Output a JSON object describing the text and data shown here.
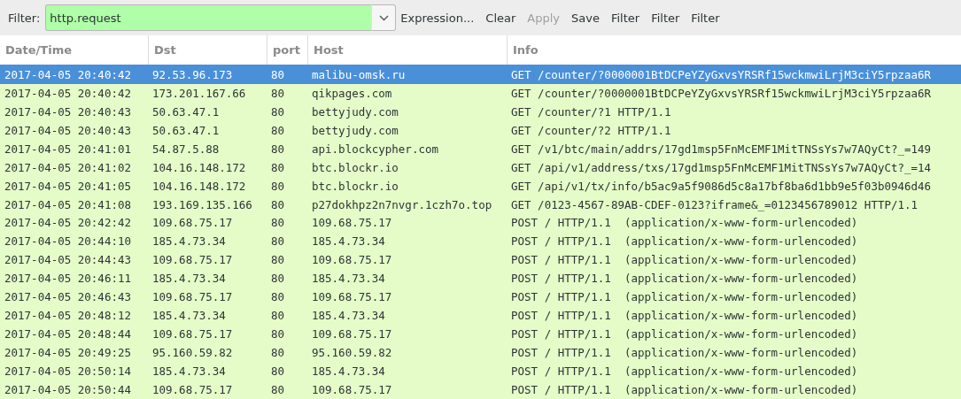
{
  "toolbar": {
    "filter_label": "Filter:",
    "filter_value": "http.request",
    "filter_valid": true,
    "buttons": [
      {
        "label": "Expression...",
        "disabled": false
      },
      {
        "label": "Clear",
        "disabled": false
      },
      {
        "label": "Apply",
        "disabled": true
      },
      {
        "label": "Save",
        "disabled": false
      },
      {
        "label": "Filter",
        "disabled": false
      },
      {
        "label": "Filter",
        "disabled": false
      },
      {
        "label": "Filter",
        "disabled": false
      }
    ]
  },
  "table": {
    "columns": [
      "Date/Time",
      "Dst",
      "port",
      "Host",
      "Info"
    ],
    "rows": [
      {
        "selected": true,
        "cells": [
          "2017-04-05 20:40:42",
          "92.53.96.173",
          "80",
          "malibu-omsk.ru",
          "GET /counter/?0000001BtDCPeYZyGxvsYRSRf15wckmwiLrjM3ciY5rpzaa6R"
        ]
      },
      {
        "selected": false,
        "cells": [
          "2017-04-05 20:40:42",
          "173.201.167.66",
          "80",
          "qikpages.com",
          "GET /counter/?0000001BtDCPeYZyGxvsYRSRf15wckmwiLrjM3ciY5rpzaa6R"
        ]
      },
      {
        "selected": false,
        "cells": [
          "2017-04-05 20:40:43",
          "50.63.47.1",
          "80",
          "bettyjudy.com",
          "GET /counter/?1 HTTP/1.1"
        ]
      },
      {
        "selected": false,
        "cells": [
          "2017-04-05 20:40:43",
          "50.63.47.1",
          "80",
          "bettyjudy.com",
          "GET /counter/?2 HTTP/1.1"
        ]
      },
      {
        "selected": false,
        "cells": [
          "2017-04-05 20:41:01",
          "54.87.5.88",
          "80",
          "api.blockcypher.com",
          "GET /v1/btc/main/addrs/17gd1msp5FnMcEMF1MitTNSsYs7w7AQyCt?_=149"
        ]
      },
      {
        "selected": false,
        "cells": [
          "2017-04-05 20:41:02",
          "104.16.148.172",
          "80",
          "btc.blockr.io",
          "GET /api/v1/address/txs/17gd1msp5FnMcEMF1MitTNSsYs7w7AQyCt?_=14"
        ]
      },
      {
        "selected": false,
        "cells": [
          "2017-04-05 20:41:05",
          "104.16.148.172",
          "80",
          "btc.blockr.io",
          "GET /api/v1/tx/info/b5ac9a5f9086d5c8a17bf8ba6d1bb9e5f03b0946d46"
        ]
      },
      {
        "selected": false,
        "cells": [
          "2017-04-05 20:41:08",
          "193.169.135.166",
          "80",
          "p27dokhpz2n7nvgr.1czh7o.top",
          "GET /0123-4567-89AB-CDEF-0123?iframe&_=0123456789012 HTTP/1.1"
        ]
      },
      {
        "selected": false,
        "cells": [
          "2017-04-05 20:42:42",
          "109.68.75.17",
          "80",
          "109.68.75.17",
          "POST / HTTP/1.1  (application/x-www-form-urlencoded)"
        ]
      },
      {
        "selected": false,
        "cells": [
          "2017-04-05 20:44:10",
          "185.4.73.34",
          "80",
          "185.4.73.34",
          "POST / HTTP/1.1  (application/x-www-form-urlencoded)"
        ]
      },
      {
        "selected": false,
        "cells": [
          "2017-04-05 20:44:43",
          "109.68.75.17",
          "80",
          "109.68.75.17",
          "POST / HTTP/1.1  (application/x-www-form-urlencoded)"
        ]
      },
      {
        "selected": false,
        "cells": [
          "2017-04-05 20:46:11",
          "185.4.73.34",
          "80",
          "185.4.73.34",
          "POST / HTTP/1.1  (application/x-www-form-urlencoded)"
        ]
      },
      {
        "selected": false,
        "cells": [
          "2017-04-05 20:46:43",
          "109.68.75.17",
          "80",
          "109.68.75.17",
          "POST / HTTP/1.1  (application/x-www-form-urlencoded)"
        ]
      },
      {
        "selected": false,
        "cells": [
          "2017-04-05 20:48:12",
          "185.4.73.34",
          "80",
          "185.4.73.34",
          "POST / HTTP/1.1  (application/x-www-form-urlencoded)"
        ]
      },
      {
        "selected": false,
        "cells": [
          "2017-04-05 20:48:44",
          "109.68.75.17",
          "80",
          "109.68.75.17",
          "POST / HTTP/1.1  (application/x-www-form-urlencoded)"
        ]
      },
      {
        "selected": false,
        "cells": [
          "2017-04-05 20:49:25",
          "95.160.59.82",
          "80",
          "95.160.59.82",
          "POST / HTTP/1.1  (application/x-www-form-urlencoded)"
        ]
      },
      {
        "selected": false,
        "cells": [
          "2017-04-05 20:50:14",
          "185.4.73.34",
          "80",
          "185.4.73.34",
          "POST / HTTP/1.1  (application/x-www-form-urlencoded)"
        ]
      },
      {
        "selected": false,
        "cells": [
          "2017-04-05 20:50:44",
          "109.68.75.17",
          "80",
          "109.68.75.17",
          "POST / HTTP/1.1  (application/x-www-form-urlencoded)"
        ]
      }
    ]
  }
}
